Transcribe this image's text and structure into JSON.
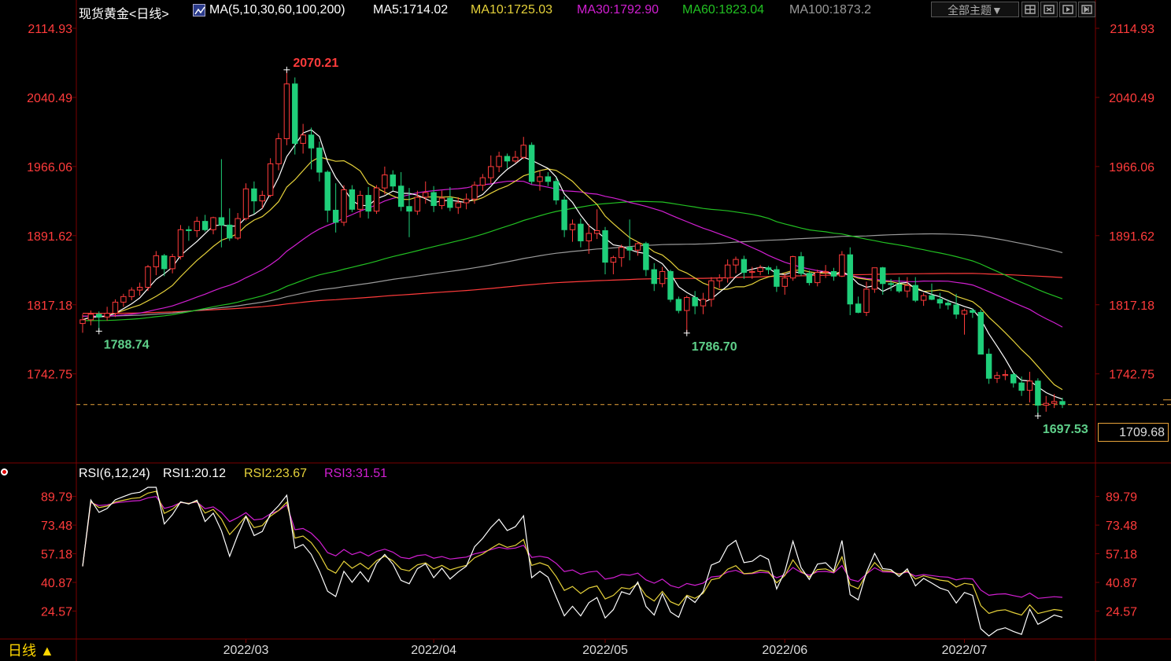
{
  "header": {
    "instrument": "现货黄金<日线>",
    "ma_label": "MA(5,10,30,60,100,200)",
    "ma5": "MA5:1714.02",
    "ma10": "MA10:1725.03",
    "ma30": "MA30:1792.90",
    "ma60": "MA60:1823.04",
    "ma100": "MA100:1873.2"
  },
  "toolbar": {
    "theme_label": "全部主题▼",
    "icons": [
      "grid-icon",
      "expand-icon",
      "play-icon",
      "next-icon"
    ]
  },
  "rsi_header": {
    "label": "RSI(6,12,24)",
    "rsi1": "RSI1:20.12",
    "rsi2": "RSI2:23.67",
    "rsi3": "RSI3:31.51"
  },
  "period_button": "日线 ▲",
  "current_price": "1709.68",
  "colors": {
    "up": "#ff3b3b",
    "down": "#1fcf7a",
    "ma5": "#ffffff",
    "ma10": "#e6d23a",
    "ma30": "#d21fd2",
    "ma60": "#22c022",
    "ma100": "#9a9a9a",
    "ma200": "#ff3b3b",
    "axis_text": "#ff3b3b",
    "grid": "#3a0000"
  },
  "chart_data": [
    {
      "type": "candlestick",
      "title": "现货黄金 日线",
      "ylim": [
        1690,
        2120
      ],
      "y_ticks": [
        "2114.93",
        "2040.49",
        "1966.06",
        "1891.62",
        "1817.18",
        "1742.75"
      ],
      "x_ticks": [
        "2022/03",
        "2022/04",
        "2022/05",
        "2022/06",
        "2022/07"
      ],
      "annotations": [
        {
          "text": "2070.21",
          "price": 2070.21,
          "type": "high"
        },
        {
          "text": "1788.74",
          "price": 1788.74,
          "type": "low"
        },
        {
          "text": "1786.70",
          "price": 1786.7,
          "type": "low"
        },
        {
          "text": "1697.53",
          "price": 1697.53,
          "type": "low"
        }
      ],
      "last_price": 1709.68,
      "ohlc": [
        [
          "2022-02-01",
          1797,
          1807,
          1787,
          1801
        ],
        [
          "2022-02-02",
          1801,
          1811,
          1795,
          1807
        ],
        [
          "2022-02-03",
          1807,
          1810,
          1788.74,
          1804
        ],
        [
          "2022-02-04",
          1804,
          1815,
          1800,
          1808
        ],
        [
          "2022-02-07",
          1808,
          1823,
          1804,
          1820
        ],
        [
          "2022-02-08",
          1820,
          1829,
          1815,
          1826
        ],
        [
          "2022-02-09",
          1826,
          1836,
          1822,
          1833
        ],
        [
          "2022-02-10",
          1833,
          1841,
          1827,
          1836
        ],
        [
          "2022-02-11",
          1836,
          1860,
          1832,
          1858
        ],
        [
          "2022-02-14",
          1858,
          1875,
          1849,
          1870
        ],
        [
          "2022-02-15",
          1870,
          1872,
          1848,
          1856
        ],
        [
          "2022-02-16",
          1856,
          1872,
          1851,
          1869
        ],
        [
          "2022-02-17",
          1869,
          1903,
          1866,
          1898
        ],
        [
          "2022-02-18",
          1898,
          1902,
          1886,
          1897
        ],
        [
          "2022-02-21",
          1897,
          1912,
          1890,
          1907
        ],
        [
          "2022-02-22",
          1907,
          1914,
          1896,
          1898
        ],
        [
          "2022-02-23",
          1898,
          1912,
          1893,
          1911
        ],
        [
          "2022-02-24",
          1911,
          1974,
          1879,
          1903
        ],
        [
          "2022-02-25",
          1903,
          1921,
          1886,
          1889
        ],
        [
          "2022-02-28",
          1889,
          1916,
          1887,
          1910
        ],
        [
          "2022-03-01",
          1910,
          1948,
          1908,
          1942
        ],
        [
          "2022-03-02",
          1942,
          1950,
          1915,
          1929
        ],
        [
          "2022-03-03",
          1929,
          1940,
          1921,
          1935
        ],
        [
          "2022-03-04",
          1935,
          1975,
          1933,
          1969
        ],
        [
          "2022-03-07",
          1969,
          2002,
          1962,
          1996
        ],
        [
          "2022-03-08",
          1996,
          2070.21,
          1989,
          2055
        ],
        [
          "2022-03-09",
          2055,
          2062,
          1979,
          1991
        ],
        [
          "2022-03-10",
          1991,
          2012,
          1980,
          2000
        ],
        [
          "2022-03-11",
          2000,
          2008,
          1963,
          1986
        ],
        [
          "2022-03-14",
          1986,
          1993,
          1950,
          1960
        ],
        [
          "2022-03-15",
          1960,
          1962,
          1906,
          1919
        ],
        [
          "2022-03-16",
          1919,
          1948,
          1895,
          1906
        ],
        [
          "2022-03-17",
          1906,
          1946,
          1902,
          1941
        ],
        [
          "2022-03-18",
          1941,
          1946,
          1917,
          1920
        ],
        [
          "2022-03-21",
          1920,
          1940,
          1911,
          1935
        ],
        [
          "2022-03-22",
          1935,
          1944,
          1910,
          1918
        ],
        [
          "2022-03-23",
          1918,
          1946,
          1915,
          1943
        ],
        [
          "2022-03-24",
          1943,
          1966,
          1936,
          1957
        ],
        [
          "2022-03-25",
          1957,
          1962,
          1940,
          1945
        ],
        [
          "2022-03-28",
          1945,
          1960,
          1918,
          1923
        ],
        [
          "2022-03-29",
          1923,
          1943,
          1890,
          1918
        ],
        [
          "2022-03-30",
          1918,
          1940,
          1914,
          1933
        ],
        [
          "2022-03-31",
          1933,
          1950,
          1926,
          1938
        ],
        [
          "2022-04-01",
          1938,
          1945,
          1917,
          1924
        ],
        [
          "2022-04-04",
          1924,
          1940,
          1920,
          1932
        ],
        [
          "2022-04-05",
          1932,
          1944,
          1918,
          1922
        ],
        [
          "2022-04-06",
          1922,
          1933,
          1915,
          1927
        ],
        [
          "2022-04-07",
          1927,
          1937,
          1920,
          1931
        ],
        [
          "2022-04-08",
          1931,
          1950,
          1926,
          1946
        ],
        [
          "2022-04-11",
          1946,
          1958,
          1940,
          1954
        ],
        [
          "2022-04-12",
          1954,
          1978,
          1948,
          1966
        ],
        [
          "2022-04-13",
          1966,
          1982,
          1960,
          1977
        ],
        [
          "2022-04-14",
          1977,
          1980,
          1964,
          1972
        ],
        [
          "2022-04-15",
          1972,
          1983,
          1970,
          1976
        ],
        [
          "2022-04-18",
          1976,
          1998,
          1974,
          1989
        ],
        [
          "2022-04-19",
          1989,
          1992,
          1947,
          1950
        ],
        [
          "2022-04-20",
          1950,
          1961,
          1940,
          1955
        ],
        [
          "2022-04-21",
          1955,
          1960,
          1945,
          1950
        ],
        [
          "2022-04-22",
          1950,
          1954,
          1925,
          1930
        ],
        [
          "2022-04-25",
          1930,
          1934,
          1890,
          1898
        ],
        [
          "2022-04-26",
          1898,
          1909,
          1885,
          1904
        ],
        [
          "2022-04-27",
          1904,
          1910,
          1879,
          1886
        ],
        [
          "2022-04-28",
          1886,
          1904,
          1872,
          1894
        ],
        [
          "2022-04-29",
          1894,
          1920,
          1888,
          1897
        ],
        [
          "2022-05-02",
          1897,
          1901,
          1850,
          1863
        ],
        [
          "2022-05-03",
          1863,
          1870,
          1850,
          1868
        ],
        [
          "2022-05-04",
          1868,
          1882,
          1858,
          1879
        ],
        [
          "2022-05-05",
          1879,
          1909,
          1865,
          1876
        ],
        [
          "2022-05-06",
          1876,
          1885,
          1870,
          1883
        ],
        [
          "2022-05-09",
          1883,
          1885,
          1848,
          1855
        ],
        [
          "2022-05-10",
          1855,
          1862,
          1832,
          1840
        ],
        [
          "2022-05-11",
          1840,
          1858,
          1836,
          1853
        ],
        [
          "2022-05-12",
          1853,
          1855,
          1820,
          1823
        ],
        [
          "2022-05-13",
          1823,
          1826,
          1808,
          1811
        ],
        [
          "2022-05-16",
          1811,
          1827,
          1786.7,
          1825
        ],
        [
          "2022-05-17",
          1825,
          1832,
          1807,
          1816
        ],
        [
          "2022-05-18",
          1816,
          1830,
          1807,
          1823
        ],
        [
          "2022-05-19",
          1823,
          1847,
          1815,
          1843
        ],
        [
          "2022-05-20",
          1843,
          1850,
          1835,
          1846
        ],
        [
          "2022-05-23",
          1846,
          1866,
          1841,
          1860
        ],
        [
          "2022-05-24",
          1860,
          1869,
          1851,
          1866
        ],
        [
          "2022-05-25",
          1866,
          1870,
          1845,
          1852
        ],
        [
          "2022-05-26",
          1852,
          1858,
          1845,
          1853
        ],
        [
          "2022-05-27",
          1853,
          1860,
          1849,
          1857
        ],
        [
          "2022-05-30",
          1857,
          1859,
          1850,
          1855
        ],
        [
          "2022-05-31",
          1855,
          1859,
          1831,
          1837
        ],
        [
          "2022-06-01",
          1837,
          1851,
          1828,
          1846
        ],
        [
          "2022-06-02",
          1846,
          1870,
          1843,
          1869
        ],
        [
          "2022-06-03",
          1869,
          1874,
          1848,
          1851
        ],
        [
          "2022-06-06",
          1851,
          1854,
          1838,
          1841
        ],
        [
          "2022-06-07",
          1841,
          1855,
          1837,
          1852
        ],
        [
          "2022-06-08",
          1852,
          1860,
          1846,
          1853
        ],
        [
          "2022-06-09",
          1853,
          1857,
          1843,
          1848
        ],
        [
          "2022-06-10",
          1848,
          1875,
          1847,
          1871
        ],
        [
          "2022-06-13",
          1871,
          1879,
          1806,
          1818
        ],
        [
          "2022-06-14",
          1818,
          1826,
          1808,
          1809
        ],
        [
          "2022-06-15",
          1809,
          1842,
          1805,
          1834
        ],
        [
          "2022-06-16",
          1834,
          1857,
          1830,
          1857
        ],
        [
          "2022-06-17",
          1857,
          1858,
          1828,
          1840
        ],
        [
          "2022-06-20",
          1840,
          1845,
          1832,
          1839
        ],
        [
          "2022-06-21",
          1839,
          1847,
          1830,
          1832
        ],
        [
          "2022-06-22",
          1832,
          1847,
          1825,
          1838
        ],
        [
          "2022-06-23",
          1838,
          1847,
          1820,
          1822
        ],
        [
          "2022-06-24",
          1822,
          1830,
          1816,
          1827
        ],
        [
          "2022-06-27",
          1827,
          1840,
          1822,
          1823
        ],
        [
          "2022-06-28",
          1823,
          1830,
          1813,
          1819
        ],
        [
          "2022-06-29",
          1819,
          1823,
          1812,
          1817
        ],
        [
          "2022-06-30",
          1817,
          1829,
          1802,
          1807
        ],
        [
          "2022-07-01",
          1807,
          1813,
          1785,
          1811
        ],
        [
          "2022-07-04",
          1811,
          1813,
          1803,
          1809
        ],
        [
          "2022-07-05",
          1809,
          1812,
          1764,
          1764
        ],
        [
          "2022-07-06",
          1764,
          1770,
          1732,
          1738
        ],
        [
          "2022-07-07",
          1738,
          1745,
          1733,
          1741
        ],
        [
          "2022-07-08",
          1741,
          1747,
          1736,
          1742
        ],
        [
          "2022-07-11",
          1742,
          1744,
          1728,
          1733
        ],
        [
          "2022-07-12",
          1733,
          1740,
          1719,
          1725
        ],
        [
          "2022-07-13",
          1725,
          1745,
          1712,
          1735
        ],
        [
          "2022-07-14",
          1735,
          1738,
          1697.53,
          1709
        ],
        [
          "2022-07-15",
          1709,
          1719,
          1702,
          1711
        ],
        [
          "2022-07-18",
          1711,
          1721,
          1706,
          1713
        ],
        [
          "2022-07-19",
          1713,
          1717,
          1706,
          1710
        ]
      ]
    },
    {
      "type": "line",
      "title": "RSI(6,12,24)",
      "ylim": [
        10,
        95
      ],
      "y_ticks": [
        "89.79",
        "73.48",
        "57.18",
        "40.87",
        "24.57"
      ],
      "series": [
        {
          "name": "RSI1",
          "last": 20.12
        },
        {
          "name": "RSI2",
          "last": 23.67
        },
        {
          "name": "RSI3",
          "last": 31.51
        }
      ]
    }
  ]
}
